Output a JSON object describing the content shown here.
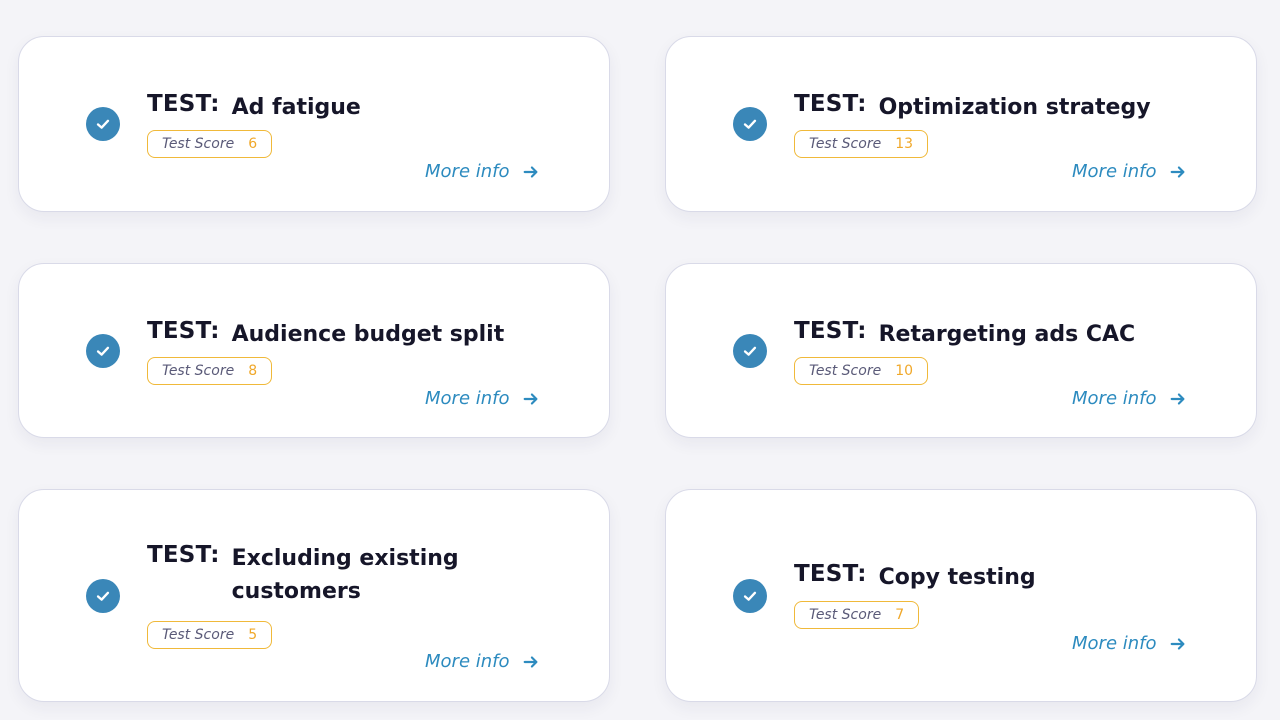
{
  "test_prefix": "TEST:",
  "score_label": "Test Score",
  "more_info_label": "More info",
  "colors": {
    "accent": "#3a87b8",
    "link": "#2d8bbf",
    "badge_border": "#f0b93a",
    "score": "#f0a82a"
  },
  "tests": [
    {
      "name": "Ad fatigue",
      "score": "6",
      "status": "completed"
    },
    {
      "name": "Optimization strategy",
      "score": "13",
      "status": "completed"
    },
    {
      "name": "Audience budget split",
      "score": "8",
      "status": "completed"
    },
    {
      "name": "Retargeting ads CAC",
      "score": "10",
      "status": "completed"
    },
    {
      "name": "Excluding existing customers",
      "score": "5",
      "status": "completed"
    },
    {
      "name": "Copy testing",
      "score": "7",
      "status": "completed"
    }
  ]
}
